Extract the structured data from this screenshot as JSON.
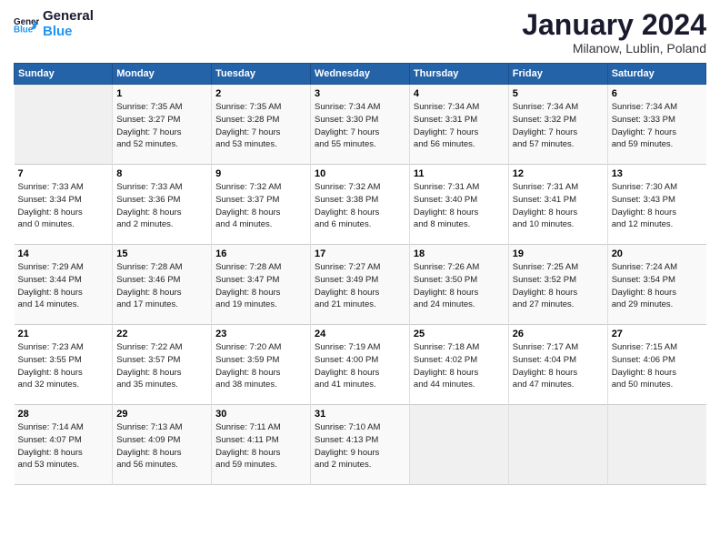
{
  "header": {
    "title": "January 2024",
    "location": "Milanow, Lublin, Poland"
  },
  "columns": [
    "Sunday",
    "Monday",
    "Tuesday",
    "Wednesday",
    "Thursday",
    "Friday",
    "Saturday"
  ],
  "weeks": [
    [
      {
        "day": "",
        "info": ""
      },
      {
        "day": "1",
        "info": "Sunrise: 7:35 AM\nSunset: 3:27 PM\nDaylight: 7 hours\nand 52 minutes."
      },
      {
        "day": "2",
        "info": "Sunrise: 7:35 AM\nSunset: 3:28 PM\nDaylight: 7 hours\nand 53 minutes."
      },
      {
        "day": "3",
        "info": "Sunrise: 7:34 AM\nSunset: 3:30 PM\nDaylight: 7 hours\nand 55 minutes."
      },
      {
        "day": "4",
        "info": "Sunrise: 7:34 AM\nSunset: 3:31 PM\nDaylight: 7 hours\nand 56 minutes."
      },
      {
        "day": "5",
        "info": "Sunrise: 7:34 AM\nSunset: 3:32 PM\nDaylight: 7 hours\nand 57 minutes."
      },
      {
        "day": "6",
        "info": "Sunrise: 7:34 AM\nSunset: 3:33 PM\nDaylight: 7 hours\nand 59 minutes."
      }
    ],
    [
      {
        "day": "7",
        "info": "Sunrise: 7:33 AM\nSunset: 3:34 PM\nDaylight: 8 hours\nand 0 minutes."
      },
      {
        "day": "8",
        "info": "Sunrise: 7:33 AM\nSunset: 3:36 PM\nDaylight: 8 hours\nand 2 minutes."
      },
      {
        "day": "9",
        "info": "Sunrise: 7:32 AM\nSunset: 3:37 PM\nDaylight: 8 hours\nand 4 minutes."
      },
      {
        "day": "10",
        "info": "Sunrise: 7:32 AM\nSunset: 3:38 PM\nDaylight: 8 hours\nand 6 minutes."
      },
      {
        "day": "11",
        "info": "Sunrise: 7:31 AM\nSunset: 3:40 PM\nDaylight: 8 hours\nand 8 minutes."
      },
      {
        "day": "12",
        "info": "Sunrise: 7:31 AM\nSunset: 3:41 PM\nDaylight: 8 hours\nand 10 minutes."
      },
      {
        "day": "13",
        "info": "Sunrise: 7:30 AM\nSunset: 3:43 PM\nDaylight: 8 hours\nand 12 minutes."
      }
    ],
    [
      {
        "day": "14",
        "info": "Sunrise: 7:29 AM\nSunset: 3:44 PM\nDaylight: 8 hours\nand 14 minutes."
      },
      {
        "day": "15",
        "info": "Sunrise: 7:28 AM\nSunset: 3:46 PM\nDaylight: 8 hours\nand 17 minutes."
      },
      {
        "day": "16",
        "info": "Sunrise: 7:28 AM\nSunset: 3:47 PM\nDaylight: 8 hours\nand 19 minutes."
      },
      {
        "day": "17",
        "info": "Sunrise: 7:27 AM\nSunset: 3:49 PM\nDaylight: 8 hours\nand 21 minutes."
      },
      {
        "day": "18",
        "info": "Sunrise: 7:26 AM\nSunset: 3:50 PM\nDaylight: 8 hours\nand 24 minutes."
      },
      {
        "day": "19",
        "info": "Sunrise: 7:25 AM\nSunset: 3:52 PM\nDaylight: 8 hours\nand 27 minutes."
      },
      {
        "day": "20",
        "info": "Sunrise: 7:24 AM\nSunset: 3:54 PM\nDaylight: 8 hours\nand 29 minutes."
      }
    ],
    [
      {
        "day": "21",
        "info": "Sunrise: 7:23 AM\nSunset: 3:55 PM\nDaylight: 8 hours\nand 32 minutes."
      },
      {
        "day": "22",
        "info": "Sunrise: 7:22 AM\nSunset: 3:57 PM\nDaylight: 8 hours\nand 35 minutes."
      },
      {
        "day": "23",
        "info": "Sunrise: 7:20 AM\nSunset: 3:59 PM\nDaylight: 8 hours\nand 38 minutes."
      },
      {
        "day": "24",
        "info": "Sunrise: 7:19 AM\nSunset: 4:00 PM\nDaylight: 8 hours\nand 41 minutes."
      },
      {
        "day": "25",
        "info": "Sunrise: 7:18 AM\nSunset: 4:02 PM\nDaylight: 8 hours\nand 44 minutes."
      },
      {
        "day": "26",
        "info": "Sunrise: 7:17 AM\nSunset: 4:04 PM\nDaylight: 8 hours\nand 47 minutes."
      },
      {
        "day": "27",
        "info": "Sunrise: 7:15 AM\nSunset: 4:06 PM\nDaylight: 8 hours\nand 50 minutes."
      }
    ],
    [
      {
        "day": "28",
        "info": "Sunrise: 7:14 AM\nSunset: 4:07 PM\nDaylight: 8 hours\nand 53 minutes."
      },
      {
        "day": "29",
        "info": "Sunrise: 7:13 AM\nSunset: 4:09 PM\nDaylight: 8 hours\nand 56 minutes."
      },
      {
        "day": "30",
        "info": "Sunrise: 7:11 AM\nSunset: 4:11 PM\nDaylight: 8 hours\nand 59 minutes."
      },
      {
        "day": "31",
        "info": "Sunrise: 7:10 AM\nSunset: 4:13 PM\nDaylight: 9 hours\nand 2 minutes."
      },
      {
        "day": "",
        "info": ""
      },
      {
        "day": "",
        "info": ""
      },
      {
        "day": "",
        "info": ""
      }
    ]
  ]
}
